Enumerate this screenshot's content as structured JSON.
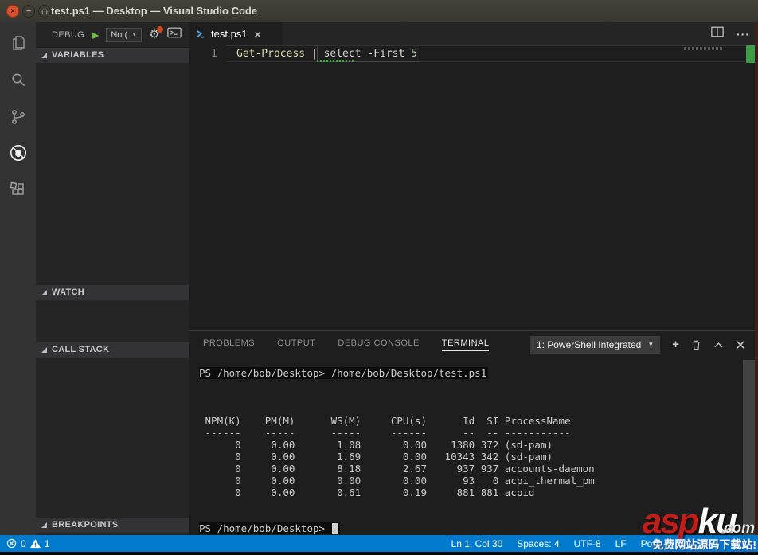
{
  "window": {
    "title": "test.ps1 — Desktop — Visual Studio Code",
    "close_glyph": "×",
    "minimize_glyph": "−",
    "maximize_glyph": "▢"
  },
  "debug_toolbar": {
    "title": "DEBUG",
    "play_glyph": "▶",
    "config_value": "No (",
    "dropdown_arrow": "▼",
    "gear_glyph": "⚙"
  },
  "sidebar": {
    "sections": [
      {
        "label": "VARIABLES"
      },
      {
        "label": "WATCH"
      },
      {
        "label": "CALL STACK"
      },
      {
        "label": "BREAKPOINTS"
      }
    ]
  },
  "editor": {
    "tab": {
      "label": "test.ps1",
      "close_glyph": "×"
    },
    "more_glyph": "···",
    "line_number": "1",
    "code_tokens": [
      {
        "text": "Get-Process",
        "color": "#dcdcaa"
      },
      {
        "text": " | ",
        "color": "#d4d4d4"
      },
      {
        "text": "select",
        "color": "#d4d4d4"
      },
      {
        "text": " -First ",
        "color": "#d4d4d4"
      },
      {
        "text": "5",
        "color": "#b5cea8"
      }
    ]
  },
  "panel": {
    "tabs": [
      {
        "label": "PROBLEMS"
      },
      {
        "label": "OUTPUT"
      },
      {
        "label": "DEBUG CONSOLE"
      },
      {
        "label": "TERMINAL"
      }
    ],
    "active_tab": "TERMINAL",
    "terminal_picker": {
      "value": "1: PowerShell Integrated",
      "arrow": "▼"
    },
    "actions": {
      "new_terminal": "+"
    }
  },
  "terminal": {
    "lines": [
      "PS /home/bob/Desktop> /home/bob/Desktop/test.ps1",
      "",
      "",
      "",
      " NPM(K)    PM(M)      WS(M)     CPU(s)      Id  SI ProcessName",
      " ------    -----      -----     ------      --  -- -----------",
      "      0     0.00       1.08       0.00    1380 372 (sd-pam)",
      "      0     0.00       1.69       0.00   10343 342 (sd-pam)",
      "      0     0.00       8.18       2.67     937 937 accounts-daemon",
      "      0     0.00       0.00       0.00      93   0 acpi_thermal_pm",
      "      0     0.00       0.61       0.19     881 881 acpid",
      "",
      "",
      "PS /home/bob/Desktop> "
    ]
  },
  "status_bar": {
    "errors": "0",
    "warnings": "1",
    "cursor_position": "Ln 1, Col 30",
    "indentation": "Spaces: 4",
    "encoding": "UTF-8",
    "eol": "LF",
    "language": "Pow"
  },
  "watermark": {
    "brand_left": "asp",
    "brand_right": "ku",
    "domain": ".com",
    "caption": "免费网站源码下载站!"
  },
  "colors": {
    "status_bar": "#007acc",
    "title_bar": "#3b3834",
    "activity_bar": "#333333",
    "sidebar": "#252526",
    "editor_bg": "#1e1e1e",
    "function_token": "#dcdcaa",
    "number_token": "#b5cea8",
    "squiggle_green": "#3ba33b",
    "overview_marker_green": "#3e9e47",
    "watermark_red": "#c01e1a"
  }
}
